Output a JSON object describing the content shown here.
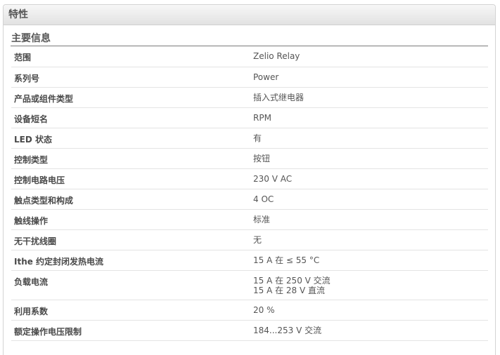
{
  "panel": {
    "header_title": "特性",
    "section_title": "主要信息"
  },
  "specs": [
    {
      "label": "范围",
      "values": [
        "Zelio Relay"
      ]
    },
    {
      "label": "系列号",
      "values": [
        "Power"
      ]
    },
    {
      "label": "产品或组件类型",
      "values": [
        "插入式继电器"
      ]
    },
    {
      "label": "设备短名",
      "values": [
        "RPM"
      ]
    },
    {
      "label": "LED 状态",
      "values": [
        "有"
      ]
    },
    {
      "label": "控制类型",
      "values": [
        "按钮"
      ]
    },
    {
      "label": "控制电路电压",
      "values": [
        "230 V AC"
      ]
    },
    {
      "label": "触点类型和构成",
      "values": [
        "4 OC"
      ]
    },
    {
      "label": "触线操作",
      "values": [
        "标准"
      ]
    },
    {
      "label": "无干扰线圈",
      "values": [
        "无"
      ]
    },
    {
      "label": "Ithe 约定封闭发热电流",
      "values": [
        "15 A 在 ≤ 55 °C"
      ]
    },
    {
      "label": "负载电流",
      "values": [
        "15 A 在 250 V 交流",
        "15 A 在 28 V 直流"
      ]
    },
    {
      "label": "利用系数",
      "values": [
        "20 %"
      ]
    },
    {
      "label": "额定操作电压限制",
      "values": [
        "184...253 V 交流"
      ]
    }
  ]
}
